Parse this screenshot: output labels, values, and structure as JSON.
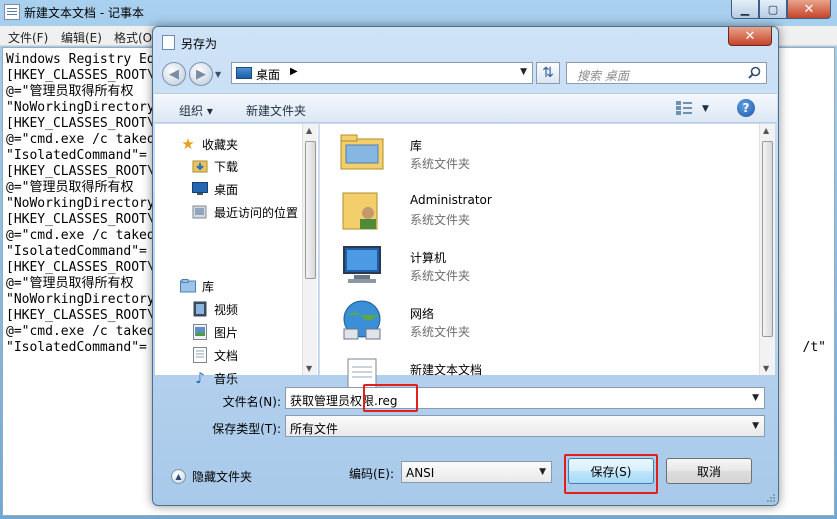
{
  "notepad": {
    "title": "新建文本文档 - 记事本",
    "menus": [
      "文件(F)",
      "编辑(E)",
      "格式(O)"
    ],
    "lines": [
      "Windows Registry Ed",
      "[HKEY_CLASSES_ROOT\\",
      "@=\"管理员取得所有权",
      "\"NoWorkingDirectory",
      "[HKEY_CLASSES_ROOT\\",
      "@=\"cmd.exe /c takeo",
      "\"IsolatedCommand\"=",
      "[HKEY_CLASSES_ROOT\\",
      "@=\"管理员取得所有权",
      "\"NoWorkingDirectory",
      "[HKEY_CLASSES_ROOT\\",
      "@=\"cmd.exe /c takeo",
      "\"IsolatedCommand\"=",
      "[HKEY_CLASSES_ROOT\\",
      "@=\"管理员取得所有权",
      "\"NoWorkingDirectory",
      "[HKEY_CLASSES_ROOT\\",
      "@=\"cmd.exe /c takeo",
      "\"IsolatedCommand\"="
    ],
    "right_fragment": "/t\""
  },
  "dialog": {
    "title": "另存为",
    "address": {
      "location": "桌面"
    },
    "search_placeholder": "搜索 桌面",
    "toolbar": {
      "organize": "组织 ▾",
      "new_folder": "新建文件夹"
    },
    "nav": {
      "favorites": "收藏夹",
      "downloads": "下载",
      "desktop": "桌面",
      "recent": "最近访问的位置",
      "libraries": "库",
      "videos": "视频",
      "pictures": "图片",
      "documents": "文档",
      "music": "音乐"
    },
    "files": [
      {
        "name": "库",
        "type": "系统文件夹"
      },
      {
        "name": "Administrator",
        "type": "系统文件夹"
      },
      {
        "name": "计算机",
        "type": "系统文件夹"
      },
      {
        "name": "网络",
        "type": "系统文件夹"
      },
      {
        "name": "新建文本文档",
        "type": ""
      }
    ],
    "filename_label": "文件名(N):",
    "filename_value": "获取管理员权限.reg",
    "savetype_label": "保存类型(T):",
    "savetype_value": "所有文件",
    "hide_folders": "隐藏文件夹",
    "encoding_label": "编码(E):",
    "encoding_value": "ANSI",
    "save_button": "保存(S)",
    "cancel_button": "取消"
  },
  "colors": {
    "highlight_box": "#e0201b",
    "window_frame": "#a8c9ea"
  }
}
